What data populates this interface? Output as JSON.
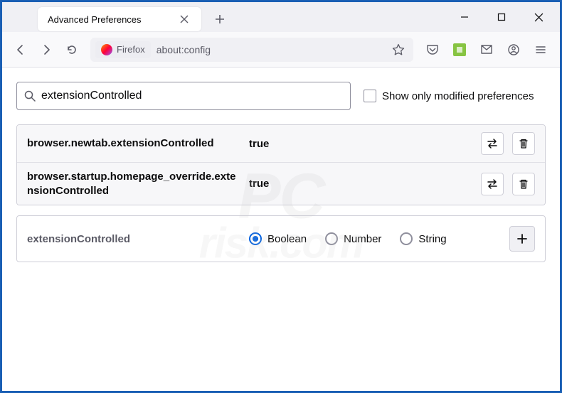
{
  "window": {
    "tab_title": "Advanced Preferences"
  },
  "toolbar": {
    "firefox_label": "Firefox",
    "url": "about:config"
  },
  "config": {
    "search_value": "extensionControlled",
    "show_modified_label": "Show only modified preferences",
    "prefs": [
      {
        "name": "browser.newtab.extensionControlled",
        "value": "true"
      },
      {
        "name": "browser.startup.homepage_override.extensionControlled",
        "value": "true"
      }
    ],
    "add": {
      "name": "extensionControlled",
      "types": [
        "Boolean",
        "Number",
        "String"
      ],
      "selected": "Boolean"
    }
  },
  "watermark": {
    "main": "PC",
    "sub": "risk.com"
  }
}
